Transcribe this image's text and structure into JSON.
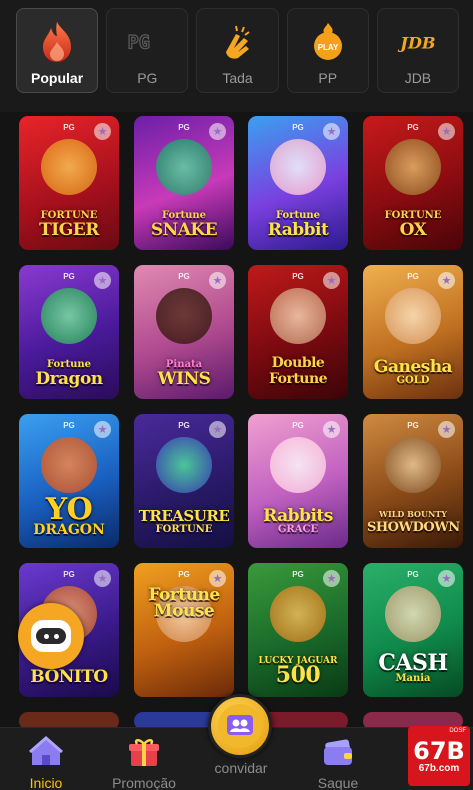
{
  "tabs": [
    {
      "label": "Popular",
      "icon": "flame-icon",
      "active": true
    },
    {
      "label": "PG",
      "icon": "pg-logo-icon"
    },
    {
      "label": "Tada",
      "icon": "tada-hand-icon"
    },
    {
      "label": "PP",
      "icon": "pp-play-icon",
      "badge": "PLAY"
    },
    {
      "label": "JDB",
      "icon": "jdb-logo-icon",
      "logo_text": "JDB"
    }
  ],
  "games": [
    {
      "title": "FORTUNE",
      "sub": "TIGER",
      "provider": "PG"
    },
    {
      "title": "Fortune",
      "sub": "SNAKE",
      "provider": "PG"
    },
    {
      "title": "Fortune",
      "sub": "Rabbit",
      "provider": "PG"
    },
    {
      "title": "FORTUNE",
      "sub": "OX",
      "provider": "PG"
    },
    {
      "title": "Fortune",
      "sub": "Dragon",
      "provider": "PG"
    },
    {
      "title": "Pinata",
      "sub": "WINS",
      "provider": "PG"
    },
    {
      "title": "Double",
      "sub": "Fortune",
      "provider": "PG"
    },
    {
      "title": "Ganesha",
      "sub": "GOLD",
      "provider": "PG"
    },
    {
      "title": "YO",
      "sub": "DRAGON",
      "provider": "PG"
    },
    {
      "title": "TREASURE",
      "sub": "FORTUNE",
      "provider": "PG"
    },
    {
      "title": "Rabbits",
      "sub": "GRACE",
      "provider": "PG"
    },
    {
      "title": "WILD BOUNTY",
      "sub": "SHOWDOWN",
      "provider": "PG"
    },
    {
      "title": "",
      "sub": "BONITO",
      "provider": "PG"
    },
    {
      "title": "Fortune",
      "sub": "Mouse",
      "provider": "PG"
    },
    {
      "title": "LUCKY JAGUAR",
      "sub": "500",
      "provider": "PG"
    },
    {
      "title": "CASH",
      "sub": "Mania",
      "provider": "PG"
    }
  ],
  "nav": {
    "inicio": "Inicio",
    "promocao": "Promoção",
    "convidar": "convidar",
    "saque": "Saque"
  },
  "brand": {
    "name": "67B",
    "domain": "67b.com",
    "tag": "DOSF"
  },
  "colors": {
    "accent": "#ffc400",
    "brand_red": "#d8141c",
    "background": "#141414"
  }
}
